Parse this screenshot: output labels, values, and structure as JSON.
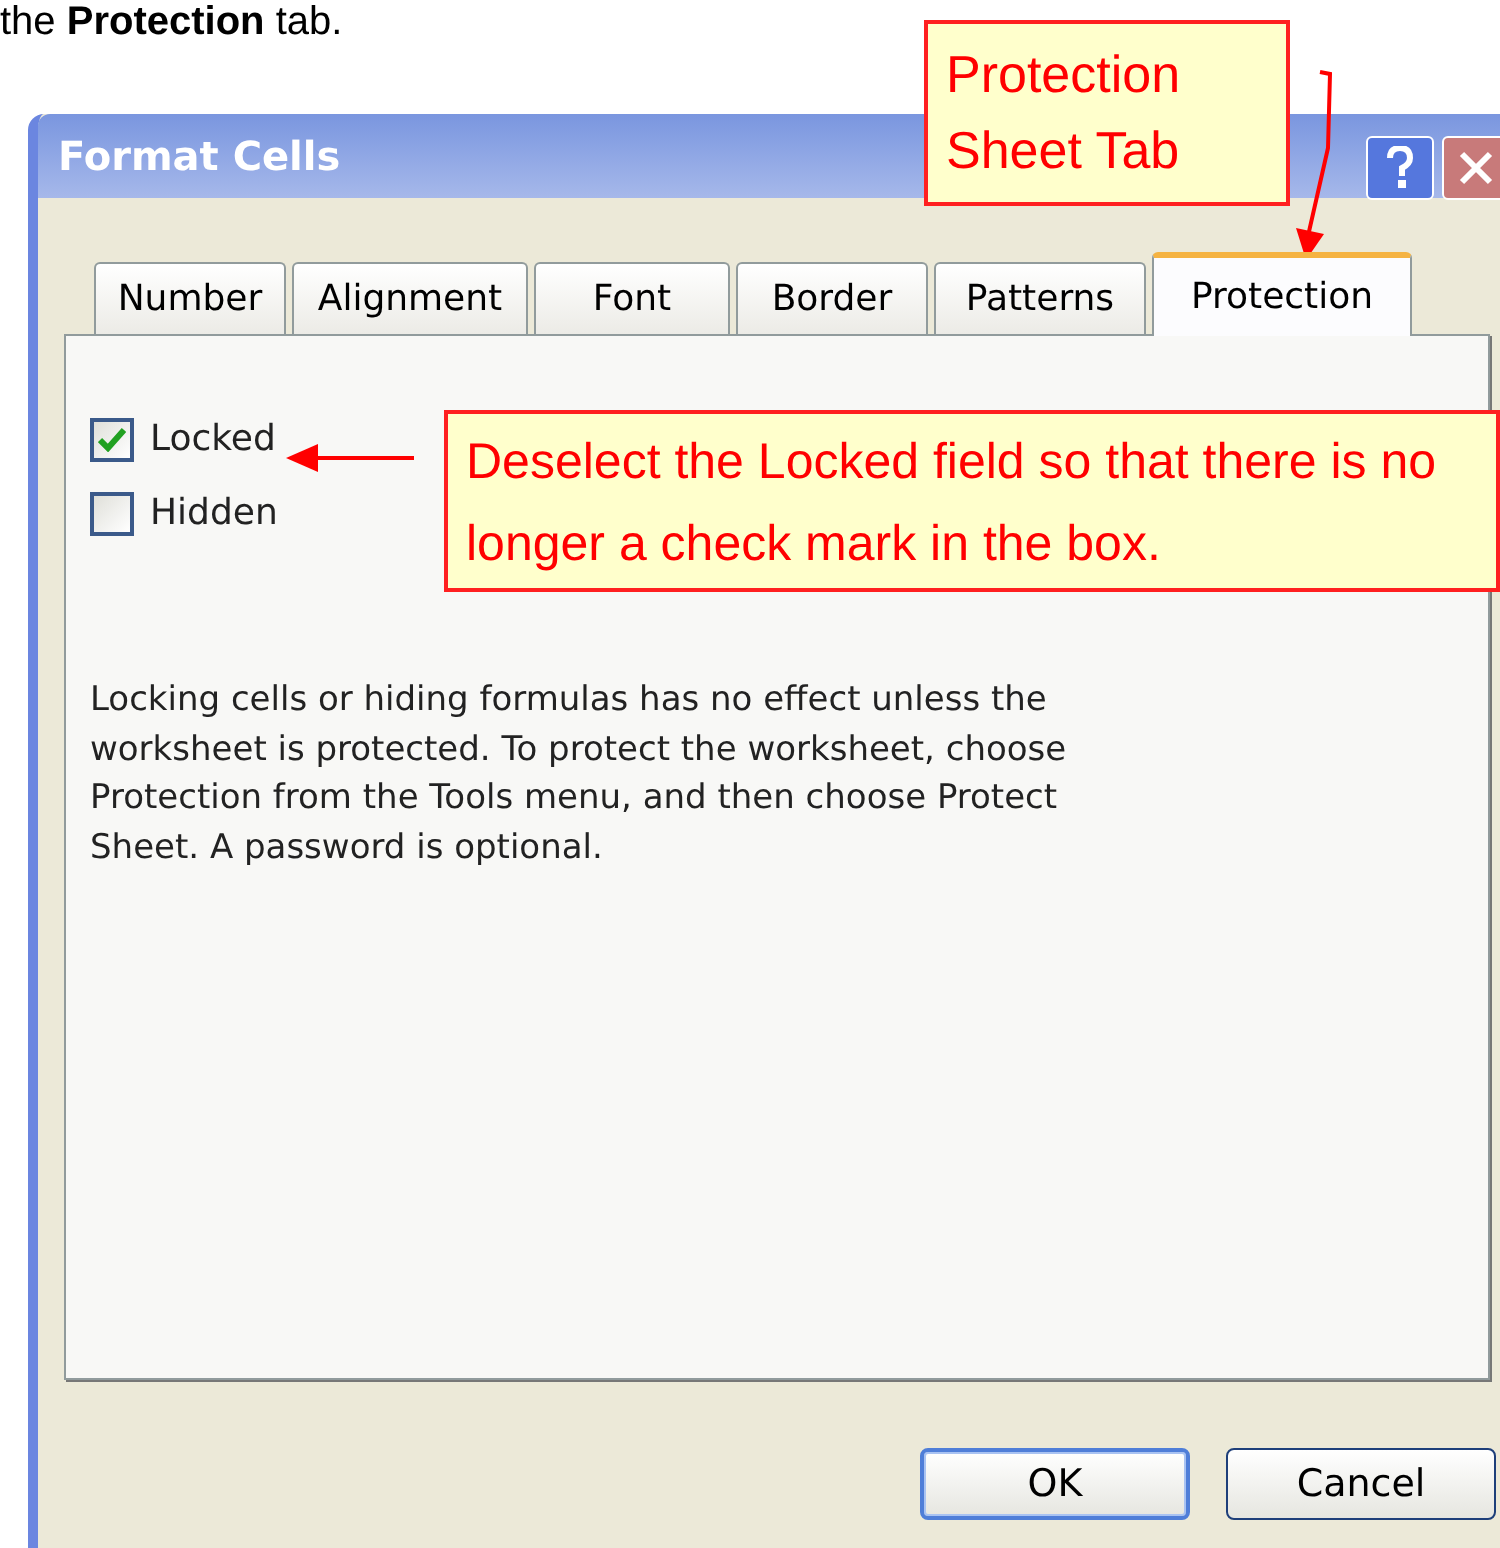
{
  "heading": "the **Protection** tab.",
  "window": {
    "title": "Format Cells"
  },
  "tabs": [
    {
      "label": "Number",
      "selected": false
    },
    {
      "label": "Alignment",
      "selected": false
    },
    {
      "label": "Font",
      "selected": false
    },
    {
      "label": "Border",
      "selected": false
    },
    {
      "label": "Patterns",
      "selected": false
    },
    {
      "label": "Protection",
      "selected": true
    }
  ],
  "options": [
    {
      "label": "Locked",
      "checked": true
    },
    {
      "label": "Hidden",
      "checked": false
    }
  ],
  "note": "Locking cells or hiding formulas has no effect unless the worksheet is protected. To protect the worksheet, choose Protection from the Tools menu, and then choose Protect Sheet. A password is optional.",
  "buttons": [
    {
      "label": "OK",
      "default": true
    },
    {
      "label": "Cancel",
      "default": false
    }
  ],
  "callouts": [
    {
      "text": "Protection Sheet Tab"
    },
    {
      "text": "Deselect the Locked field so that there is no longer a check mark in the box."
    }
  ]
}
